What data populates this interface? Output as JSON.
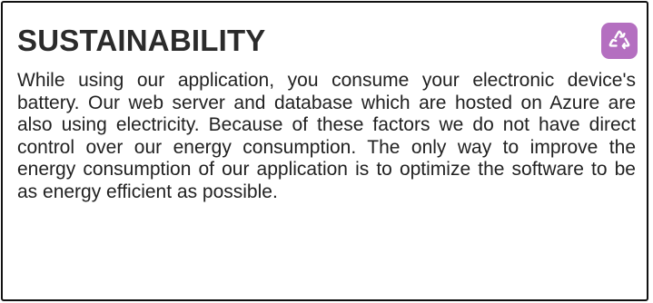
{
  "card": {
    "title": "SUSTAINABILITY",
    "icon": "recycle-icon",
    "accent_color": "#b46fc0",
    "paragraph": "While using our application, you consume your electronic device's battery. Our web server and database which are hosted on Azure are also using electricity. Because of these factors we do not have direct control over our energy consumption. The only way to improve the energy consumption of our application is to optimize the software to be as energy efficient as possible."
  }
}
